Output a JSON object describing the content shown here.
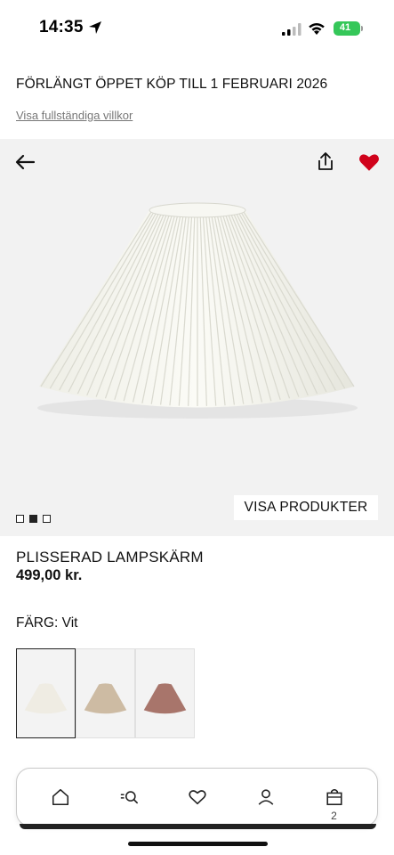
{
  "status_bar": {
    "time": "14:35",
    "battery": "41"
  },
  "banner": {
    "title": "FÖRLÄNGT ÖPPET KÖP TILL 1 FEBRUARI 2026",
    "link": "Visa fullständiga villkor"
  },
  "hero": {
    "icons": [
      "back-arrow-icon",
      "share-icon",
      "heart-icon"
    ],
    "favorite_color": "#d0021b",
    "dots": {
      "count": 3,
      "active_index": 1
    },
    "cta": "VISA PRODUKTER"
  },
  "product": {
    "name": "PLISSERAD LAMPSKÄRM",
    "price": "499,00 kr."
  },
  "color": {
    "label": "FÄRG: Vit",
    "swatches": [
      {
        "name": "white",
        "color": "#efece3",
        "selected": true
      },
      {
        "name": "beige",
        "color": "#cdbba3",
        "selected": false
      },
      {
        "name": "rose",
        "color": "#a8756b",
        "selected": false
      }
    ]
  },
  "bottom_nav": {
    "items": [
      "home-icon",
      "search-icon",
      "heart-icon",
      "user-icon",
      "bag-icon"
    ],
    "bag_count": "2"
  }
}
